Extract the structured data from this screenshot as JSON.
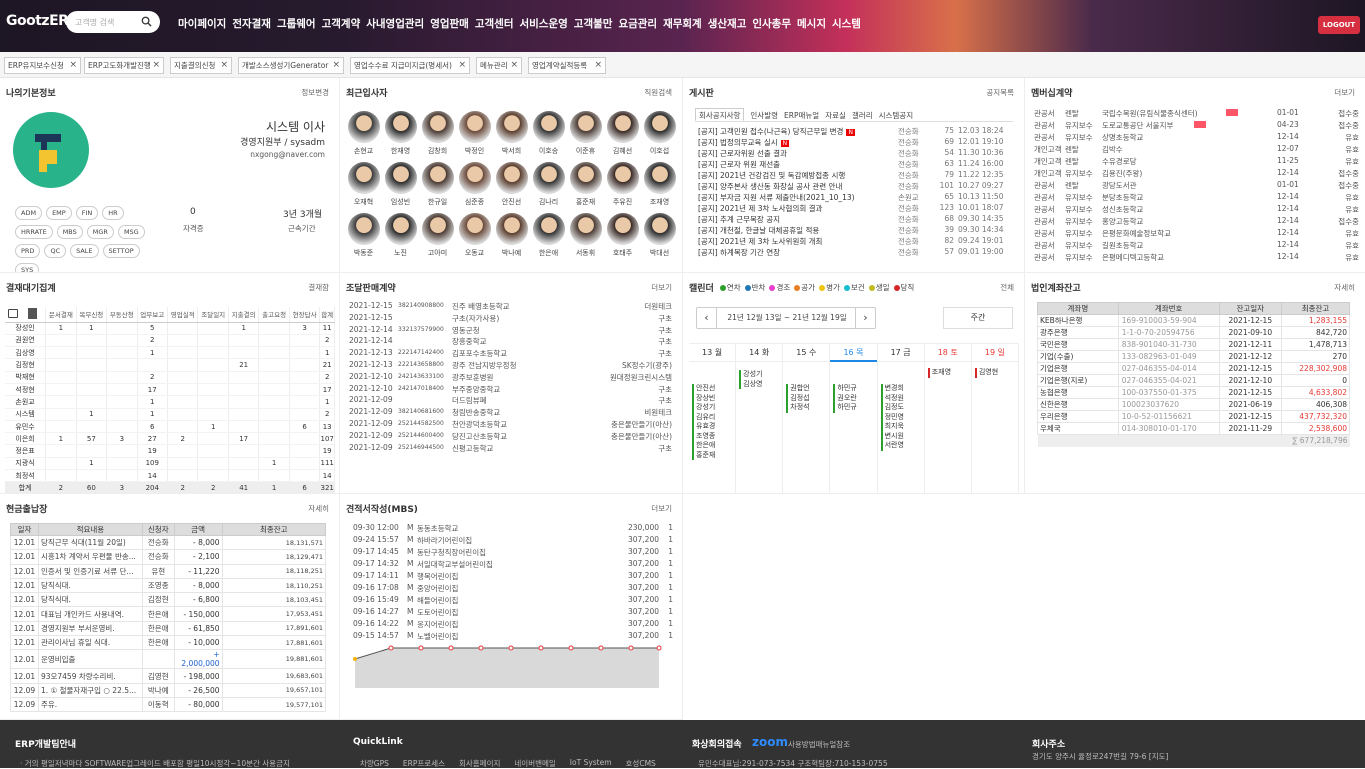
{
  "header": {
    "logo": "GootzERP",
    "search_placeholder": "고객명 검색",
    "logout": "LOGOUT",
    "menu": [
      "마이페이지",
      "전자결재",
      "그룹웨어",
      "고객계약",
      "사내영업관리",
      "영업판매",
      "고객센터",
      "서비스운영",
      "고객불만",
      "요금관리",
      "재무회계",
      "생산재고",
      "인사총무",
      "메시지",
      "시스템"
    ]
  },
  "tabs": [
    "ERP유지보수신청",
    "ERP고도화개발진행",
    "지출결의신청",
    "개발소스생성기Generator",
    "영업수수료 지급미지급(명세서)",
    "메뉴관리",
    "영업계약실적등록"
  ],
  "profile": {
    "title": "나의기본정보",
    "more": "정보변경",
    "name": "시스템 이사",
    "dept": "경영지원부 / sysadm",
    "email": "nxgong@naver.com",
    "tags": [
      "ADM",
      "EMP",
      "FIN",
      "HR",
      "HRRATE",
      "MBS",
      "MGR",
      "MSG",
      "PRD",
      "QC",
      "SALE",
      "SETTOP",
      "SYS"
    ],
    "stat1_value": "0",
    "stat1_label": "자격증",
    "stat2_value": "3년 3개월",
    "stat2_label": "근속기간"
  },
  "recent": {
    "title": "최근입사자",
    "more": "직원검색",
    "names": [
      "손현교",
      "한재영",
      "김창희",
      "박정인",
      "박서희",
      "이호승",
      "이준휴",
      "김혜선",
      "이호섭",
      "오재혁",
      "임성빈",
      "한규일",
      "심준종",
      "안진선",
      "김나리",
      "홍준재",
      "주유진",
      "조재영",
      "박동준",
      "노진",
      "고아미",
      "오동교",
      "박나예",
      "한은애",
      "서동휘",
      "호태주",
      "박대선"
    ]
  },
  "board": {
    "title": "게시판",
    "more": "공지목록",
    "tabs": [
      "회사공지사항",
      "인사발령",
      "ERP매뉴얼",
      "자료실",
      "갤러리",
      "시스템공지"
    ],
    "posts": [
      [
        "[공지] 고객민원 접수(나근육) 당직근무일 변경",
        "전승화",
        "75",
        "12.03 18:24",
        true
      ],
      [
        "[공지] 법정의무교육 실시",
        "전승화",
        "69",
        "12.01 19:10",
        true
      ],
      [
        "[공지] 근로자위원 선출 결과",
        "전승화",
        "54",
        "11.30 10:36",
        false
      ],
      [
        "[공지] 근로자 위원 재선출",
        "전승화",
        "63",
        "11.24 16:00",
        false
      ],
      [
        "[공지] 2021년 건강검진 및 독감예방접종 시행",
        "전승화",
        "79",
        "11.22 12:35",
        false
      ],
      [
        "[공지] 양주본사 생산동 화장실 공사 관련 안내",
        "전승화",
        "101",
        "10.27 09:27",
        false
      ],
      [
        "[공지] 부자금 지원 서류 제출안내(2021_10_13)",
        "손원교",
        "65",
        "10.13 11:50",
        false
      ],
      [
        "[공지] 2021년 제 3차 노사협의회 결과",
        "전승화",
        "123",
        "10.01 18:07",
        false
      ],
      [
        "[공지] 추계 근무복장 공지",
        "전승화",
        "68",
        "09.30 14:35",
        false
      ],
      [
        "[공지] 개천절, 한글날 대체공휴일 적용",
        "전승화",
        "39",
        "09.30 14:34",
        false
      ],
      [
        "[공지] 2021년 제 3차 노사위원회 개최",
        "전승화",
        "82",
        "09.24 19:01",
        false
      ],
      [
        "[공지] 하계복장 기간 연장",
        "전승화",
        "57",
        "09.01 19:00",
        false
      ]
    ]
  },
  "member": {
    "title": "멤버십계약",
    "more": "더보기",
    "rows": [
      [
        "관공서",
        "렌탈",
        "국립수목원(유림식물종식센터)",
        "01-01",
        "접수중",
        true
      ],
      [
        "관공서",
        "유지보수",
        "도로교통공단 서울지부",
        "04-23",
        "접수중",
        true
      ],
      [
        "관공서",
        "유지보수",
        "상명초등학교",
        "12-14",
        "유효",
        false
      ],
      [
        "개인고객",
        "렌탈",
        "김박수",
        "12-07",
        "유효",
        false
      ],
      [
        "개인고객",
        "렌탈",
        "수유경로당",
        "11-25",
        "유효",
        false
      ],
      [
        "개인고객",
        "유지보수",
        "김용진(주왕)",
        "12-14",
        "접수중",
        false
      ],
      [
        "관공서",
        "렌탈",
        "광당도서관",
        "01-01",
        "접수중",
        false
      ],
      [
        "관공서",
        "유지보수",
        "분당초등학교",
        "12-14",
        "유효",
        false
      ],
      [
        "관공서",
        "유지보수",
        "성신초등학교",
        "12-14",
        "유효",
        false
      ],
      [
        "관공서",
        "유지보수",
        "홍양고등학교",
        "12-14",
        "접수중",
        false
      ],
      [
        "관공서",
        "유지보수",
        "은평문화예술정보학교",
        "12-14",
        "유효",
        false
      ],
      [
        "관공서",
        "유지보수",
        "길원초등학교",
        "12-14",
        "유효",
        false
      ],
      [
        "관공서",
        "유지보수",
        "은평메디텍고등학교",
        "12-14",
        "유효",
        false
      ]
    ]
  },
  "approval": {
    "title": "결재대기집계",
    "more": "결재함",
    "headers": [
      "",
      "문서결재",
      "복무신청",
      "부동산청",
      "업무보고",
      "영업실적",
      "조달일지",
      "지출결의",
      "출고요청",
      "현장답사",
      "합계"
    ],
    "rows": [
      [
        "장성인",
        "1",
        "1",
        "",
        "5",
        "",
        "",
        "1",
        "",
        "3",
        "11"
      ],
      [
        "권원연",
        "",
        "",
        "",
        "2",
        "",
        "",
        "",
        "",
        "",
        "2"
      ],
      [
        "김상영",
        "",
        "",
        "",
        "1",
        "",
        "",
        "",
        "",
        "",
        "1"
      ],
      [
        "김정현",
        "",
        "",
        "",
        "",
        "",
        "",
        "21",
        "",
        "",
        "21"
      ],
      [
        "박재현",
        "",
        "",
        "",
        "2",
        "",
        "",
        "",
        "",
        "",
        "2"
      ],
      [
        "석정현",
        "",
        "",
        "",
        "17",
        "",
        "",
        "",
        "",
        "",
        "17"
      ],
      [
        "손원교",
        "",
        "",
        "",
        "1",
        "",
        "",
        "",
        "",
        "",
        "1"
      ],
      [
        "시스템",
        "",
        "1",
        "",
        "1",
        "",
        "",
        "",
        "",
        "",
        "2"
      ],
      [
        "유민수",
        "",
        "",
        "",
        "6",
        "",
        "1",
        "",
        "",
        "6",
        "13"
      ],
      [
        "이은희",
        "1",
        "57",
        "3",
        "27",
        "2",
        "",
        "17",
        "",
        "",
        "107"
      ],
      [
        "정은표",
        "",
        "",
        "",
        "19",
        "",
        "",
        "",
        "",
        "",
        "19"
      ],
      [
        "지광식",
        "",
        "1",
        "",
        "109",
        "",
        "",
        "",
        "1",
        "",
        "111"
      ],
      [
        "최정석",
        "",
        "",
        "",
        "14",
        "",
        "",
        "",
        "",
        "",
        "14"
      ],
      [
        "합계",
        "2",
        "60",
        "3",
        "204",
        "2",
        "2",
        "41",
        "1",
        "6",
        "321"
      ]
    ]
  },
  "procure": {
    "title": "조달판매계약",
    "more": "더보기",
    "rows": [
      [
        "2021-12-15",
        "382140908800",
        "진주 배영초등학교",
        "더원테크"
      ],
      [
        "2021-12-15",
        "",
        "구초(자가사용)",
        "구초"
      ],
      [
        "2021-12-14",
        "332137579900",
        "영동군청",
        "구초"
      ],
      [
        "2021-12-14",
        "",
        "장흥중학교",
        "구초"
      ],
      [
        "2021-12-13",
        "222147142400",
        "김포포수초등학교",
        "구초"
      ],
      [
        "2021-12-13",
        "222143658800",
        "광주 전남지방우정청",
        "SK정수기(광주)"
      ],
      [
        "2021-12-10",
        "242143633100",
        "광주보훈병원",
        "원대정원크린시스템"
      ],
      [
        "2021-12-10",
        "242147018400",
        "부주중앙중학교",
        "구초"
      ],
      [
        "2021-12-09",
        "",
        "더드림뷰폐",
        "구초"
      ],
      [
        "2021-12-09",
        "382140681600",
        "청림반송중학교",
        "비원테크"
      ],
      [
        "2021-12-09",
        "252144582500",
        "천안광덕초등학교",
        "충은물만들기(아산)"
      ],
      [
        "2021-12-09",
        "252144600400",
        "당진고산초등학교",
        "충은물만들기(아산)"
      ],
      [
        "2021-12-09",
        "252146944500",
        "신평고등학교",
        "구초"
      ]
    ]
  },
  "calendar": {
    "title": "캘린더",
    "more": "전체",
    "legend": [
      [
        "연차",
        "#2ca02c"
      ],
      [
        "반차",
        "#1f77b4"
      ],
      [
        "경조",
        "#e83ecf"
      ],
      [
        "공가",
        "#e67e22"
      ],
      [
        "병가",
        "#f1c40f"
      ],
      [
        "보건",
        "#17becf"
      ],
      [
        "생일",
        "#bcbd22"
      ],
      [
        "당직",
        "#d62728"
      ]
    ],
    "range": "21년 12월 13일 ~ 21년 12월 19일",
    "view": "주간",
    "days": [
      "13 월",
      "14 화",
      "15 수",
      "16 목",
      "17 금",
      "18 토",
      "19 일"
    ],
    "events": [
      [
        "안진선",
        "장상빈",
        "강성기",
        "김유리",
        "유효경",
        "조영종",
        "한은애",
        "홍준재"
      ],
      [
        "강성기",
        "김상영"
      ],
      [
        "권합언",
        "김정섭",
        "차정석"
      ],
      [
        "하민규",
        "권오란",
        "하민규"
      ],
      [
        "변경희",
        "석정원",
        "김정도",
        "정민영",
        "최지욱",
        "변시원",
        "서란영"
      ],
      [
        "조재영"
      ],
      [
        "김영현"
      ]
    ]
  },
  "bank": {
    "title": "법인계좌잔고",
    "more": "자세히",
    "headers": [
      "계좌명",
      "계좌번호",
      "잔고일자",
      "최종잔고"
    ],
    "rows": [
      [
        "KEB하나은행",
        "169-910003-59-904",
        "2021-12-15",
        "1,283,155",
        true
      ],
      [
        "광주은행",
        "1-1-0-70-20594756",
        "2021-09-10",
        "842,720",
        false
      ],
      [
        "국민은행",
        "838-901040-31-730",
        "2021-12-11",
        "1,478,713",
        false
      ],
      [
        "기업(수출)",
        "133-082963-01-049",
        "2021-12-12",
        "270",
        false
      ],
      [
        "기업은행",
        "027-046355-04-014",
        "2021-12-15",
        "228,302,908",
        true
      ],
      [
        "기업은행(지로)",
        "027-046355-04-021",
        "2021-12-10",
        "0",
        false
      ],
      [
        "농협은행",
        "100-037550-01-375",
        "2021-12-15",
        "4,633,802",
        true
      ],
      [
        "신한은행",
        "100023037620",
        "2021-06-19",
        "406,308",
        false
      ],
      [
        "우리은행",
        "10-0-52-01156621",
        "2021-12-15",
        "437,732,320",
        true
      ],
      [
        "우체국",
        "014-308010-01-170",
        "2021-11-29",
        "2,538,600",
        true
      ]
    ],
    "total": "∑ 677,218,796"
  },
  "cash": {
    "title": "현금출납장",
    "more": "자세히",
    "headers": [
      "일자",
      "적요내용",
      "신청자",
      "금액",
      "최종잔고"
    ],
    "rows": [
      [
        "12.01",
        "당직근무 식대(11월 20일)",
        "전승화",
        "- 8,000",
        "18,131,571"
      ],
      [
        "12.01",
        "시흥1차 계약서 우편물 반송...",
        "전승화",
        "- 2,100",
        "18,129,471"
      ],
      [
        "12.01",
        "인증서 및 인증기료 서류 단...",
        "유현",
        "- 11,220",
        "18,118,251"
      ],
      [
        "12.01",
        "당직식대.",
        "조영종",
        "- 8,000",
        "18,110,251"
      ],
      [
        "12.01",
        "당직식대.",
        "김정현",
        "- 6,800",
        "18,103,451"
      ],
      [
        "12.01",
        "대표님 개인카드 사용내역.",
        "한은애",
        "- 150,000",
        "17,953,451"
      ],
      [
        "12.01",
        "경영지원부 부서운영비.",
        "한은애",
        "- 61,850",
        "17,891,601"
      ],
      [
        "12.01",
        "관리이사님 휴일 식대.",
        "한은애",
        "- 10,000",
        "17,881,601"
      ],
      [
        "12.01",
        "운영비입출",
        "",
        "+ 2,000,000",
        "19,881,601"
      ],
      [
        "12.01",
        "93오7459 차량수리비.",
        "김영현",
        "- 198,000",
        "19,683,601"
      ],
      [
        "12.09",
        "1. ① 철물자재구입 ○ 22.5...",
        "박나예",
        "- 26,500",
        "19,657,101"
      ],
      [
        "12.09",
        "주유.",
        "이동혁",
        "- 80,000",
        "19,577,101"
      ]
    ]
  },
  "estimate": {
    "title": "견적서작성(MBS)",
    "more": "더보기",
    "rows": [
      [
        "09-30 12:00",
        "M",
        "동동초등학교",
        "230,000",
        "1"
      ],
      [
        "09-24 15:57",
        "M",
        "하바라기어린이집",
        "307,200",
        "1"
      ],
      [
        "09-17 14:45",
        "M",
        "동탄구청직장어린이집",
        "307,200",
        "1"
      ],
      [
        "09-17 14:32",
        "M",
        "서일대학교부설어린이집",
        "307,200",
        "1"
      ],
      [
        "09-17 14:11",
        "M",
        "행복어린이집",
        "307,200",
        "1"
      ],
      [
        "09-16 17:08",
        "M",
        "중앙어린이집",
        "307,200",
        "1"
      ],
      [
        "09-16 15:49",
        "M",
        "해들어린이집",
        "307,200",
        "1"
      ],
      [
        "09-16 14:27",
        "M",
        "도토어린이집",
        "307,200",
        "1"
      ],
      [
        "09-16 14:22",
        "M",
        "옹지어린이집",
        "307,200",
        "1"
      ],
      [
        "09-15 14:57",
        "M",
        "노벨어린이집",
        "307,200",
        "1"
      ]
    ]
  },
  "footer": {
    "c1_title": "ERP개발팀안내",
    "c1_sub": "· 거의 평일저녁마다 SOFTWARE업그레이드 배포함 평일10시정각~10분간 사용금지",
    "c2_title": "QuickLink",
    "c2_links": [
      "차량GPS",
      "ERP프로세스",
      "회사홈페이지",
      "네이버밴메일",
      "IoT System",
      "호성CMS"
    ],
    "c3_title": "화상회의접속",
    "c3_zoom": "zoom",
    "c3_zoom_sub": "사용방법매뉴얼참조",
    "c3_sub": "유민수대표님:291-073-7534    구조혁팀장:710-153-0755",
    "c4_title": "회사주소",
    "c4_sub": "경기도 양주시 율정로247번길 79-6   [지도]"
  }
}
